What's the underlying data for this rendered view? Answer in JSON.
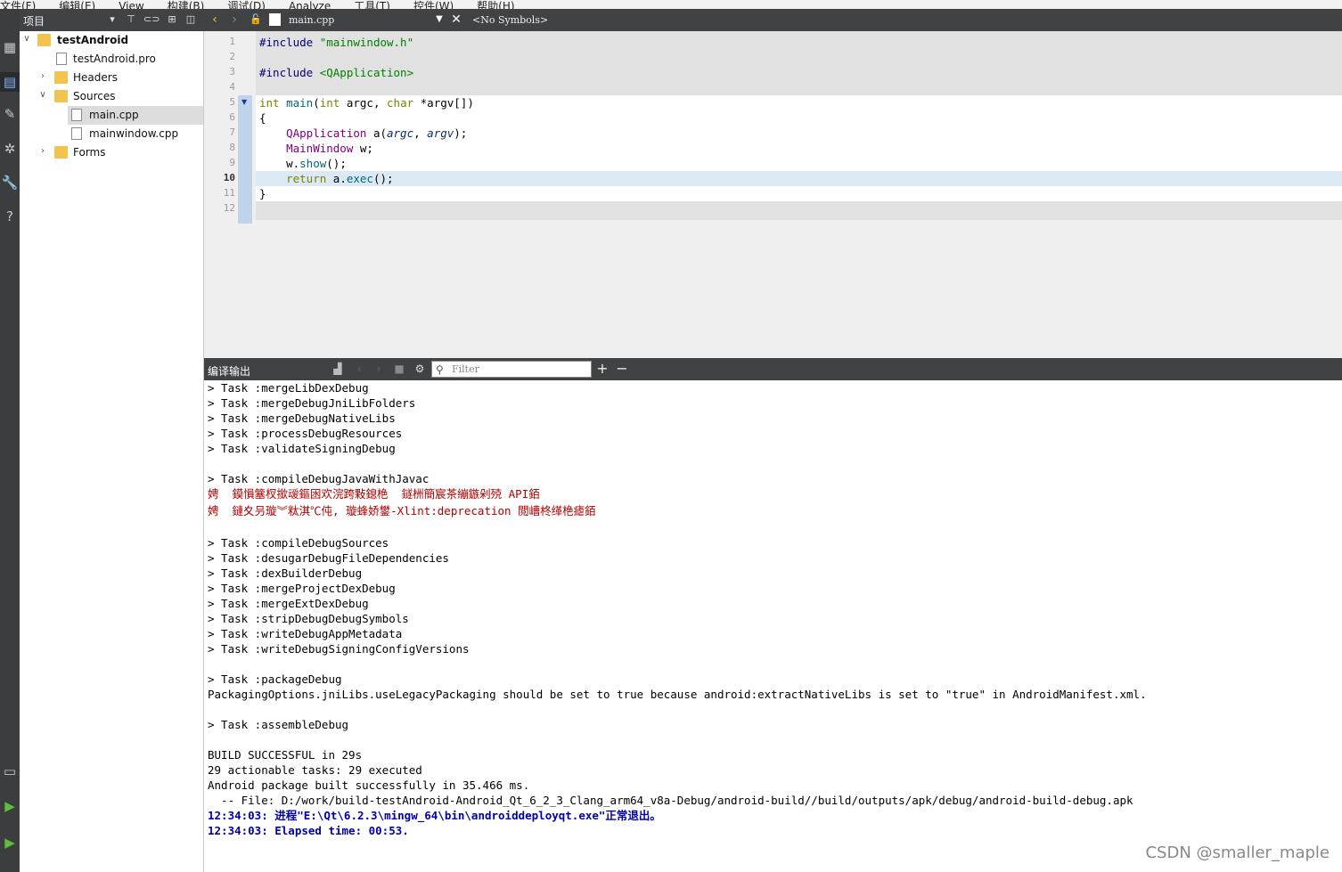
{
  "menubar": [
    "文件(F)",
    "编辑(E)",
    "View",
    "构建(B)",
    "调试(D)",
    "Analyze",
    "工具(T)",
    "控件(W)",
    "帮助(H)"
  ],
  "project_panel": {
    "title": "项目",
    "tree": [
      {
        "label": "testAndroid",
        "type": "project",
        "expanded": true
      },
      {
        "label": "testAndroid.pro",
        "type": "pro-file"
      },
      {
        "label": "Headers",
        "type": "folder",
        "expanded": false
      },
      {
        "label": "Sources",
        "type": "folder",
        "expanded": true
      },
      {
        "label": "main.cpp",
        "type": "cpp-file",
        "selected": true
      },
      {
        "label": "mainwindow.cpp",
        "type": "cpp-file"
      },
      {
        "label": "Forms",
        "type": "folder",
        "expanded": false
      }
    ]
  },
  "editor": {
    "file_name": "main.cpp",
    "symbols": "<No Symbols>",
    "current_line": "10",
    "line_numbers": [
      "1",
      "2",
      "3",
      "4",
      "5",
      "6",
      "7",
      "8",
      "9",
      "10",
      "11",
      "12"
    ],
    "lines": [
      {
        "parts": [
          {
            "t": "#include ",
            "c": "pp"
          },
          {
            "t": "\"mainwindow.h\"",
            "c": "str"
          }
        ]
      },
      {
        "parts": []
      },
      {
        "parts": [
          {
            "t": "#include ",
            "c": "pp"
          },
          {
            "t": "<QApplication>",
            "c": "str"
          }
        ]
      },
      {
        "parts": []
      },
      {
        "parts": [
          {
            "t": "int ",
            "c": "kw"
          },
          {
            "t": "main",
            "c": "fn"
          },
          {
            "t": "(",
            "c": ""
          },
          {
            "t": "int ",
            "c": "kw"
          },
          {
            "t": "argc, ",
            "c": ""
          },
          {
            "t": "char ",
            "c": "kw"
          },
          {
            "t": "*argv[])",
            "c": ""
          }
        ]
      },
      {
        "parts": [
          {
            "t": "{",
            "c": ""
          }
        ]
      },
      {
        "parts": [
          {
            "t": "    QApplication ",
            "c": "ty"
          },
          {
            "t": "a(",
            "c": ""
          },
          {
            "t": "argc",
            "c": "it"
          },
          {
            "t": ", ",
            "c": ""
          },
          {
            "t": "argv",
            "c": "it"
          },
          {
            "t": ");",
            "c": ""
          }
        ]
      },
      {
        "parts": [
          {
            "t": "    MainWindow ",
            "c": "ty"
          },
          {
            "t": "w;",
            "c": ""
          }
        ]
      },
      {
        "parts": [
          {
            "t": "    w.",
            "c": ""
          },
          {
            "t": "show",
            "c": "fn"
          },
          {
            "t": "();",
            "c": ""
          }
        ]
      },
      {
        "parts": [
          {
            "t": "    return ",
            "c": "kw"
          },
          {
            "t": "a.",
            "c": ""
          },
          {
            "t": "exec",
            "c": "fn"
          },
          {
            "t": "();",
            "c": ""
          }
        ]
      },
      {
        "parts": [
          {
            "t": "}",
            "c": ""
          }
        ]
      },
      {
        "parts": []
      }
    ]
  },
  "output_panel": {
    "title": "编译输出",
    "filter_placeholder": "Filter",
    "lines": [
      {
        "text": "> Task :mergeLibDexDebug",
        "style": ""
      },
      {
        "text": "> Task :mergeDebugJniLibFolders",
        "style": ""
      },
      {
        "text": "> Task :mergeDebugNativeLibs",
        "style": ""
      },
      {
        "text": "> Task :processDebugResources",
        "style": ""
      },
      {
        "text": "> Task :validateSigningDebug",
        "style": ""
      },
      {
        "text": "",
        "style": ""
      },
      {
        "text": "> Task :compileDebugJavaWithJavac",
        "style": ""
      },
      {
        "text": "娉  鏌愪簺杈撳叆鏂囦欢浣跨敤鎴栬  鐩栦簡宸茶繃鏃剁殑 API銆",
        "style": "err"
      },
      {
        "text": "娉  鏈夊叧璇︾粏淇℃伅, 璇蜂娇鐢-Xlint:deprecation 閲嶆柊缂栬瘧銆",
        "style": "err"
      },
      {
        "text": "",
        "style": ""
      },
      {
        "text": "> Task :compileDebugSources",
        "style": ""
      },
      {
        "text": "> Task :desugarDebugFileDependencies",
        "style": ""
      },
      {
        "text": "> Task :dexBuilderDebug",
        "style": ""
      },
      {
        "text": "> Task :mergeProjectDexDebug",
        "style": ""
      },
      {
        "text": "> Task :mergeExtDexDebug",
        "style": ""
      },
      {
        "text": "> Task :stripDebugDebugSymbols",
        "style": ""
      },
      {
        "text": "> Task :writeDebugAppMetadata",
        "style": ""
      },
      {
        "text": "> Task :writeDebugSigningConfigVersions",
        "style": ""
      },
      {
        "text": "",
        "style": ""
      },
      {
        "text": "> Task :packageDebug",
        "style": ""
      },
      {
        "text": "PackagingOptions.jniLibs.useLegacyPackaging should be set to true because android:extractNativeLibs is set to \"true\" in AndroidManifest.xml.",
        "style": ""
      },
      {
        "text": "",
        "style": ""
      },
      {
        "text": "> Task :assembleDebug",
        "style": ""
      },
      {
        "text": "",
        "style": ""
      },
      {
        "text": "BUILD SUCCESSFUL in 29s",
        "style": ""
      },
      {
        "text": "29 actionable tasks: 29 executed",
        "style": ""
      },
      {
        "text": "Android package built successfully in 35.466 ms.",
        "style": ""
      },
      {
        "text": "  -- File: D:/work/build-testAndroid-Android_Qt_6_2_3_Clang_arm64_v8a-Debug/android-build//build/outputs/apk/debug/android-build-debug.apk",
        "style": ""
      },
      {
        "text": "12:34:03: 进程\"E:\\Qt\\6.2.3\\mingw_64\\bin\\androiddeployqt.exe\"正常退出。",
        "style": "info"
      },
      {
        "text": "12:34:03: Elapsed time: 00:53.",
        "style": "info"
      }
    ]
  },
  "watermark": "CSDN @smaller_maple",
  "colors": {
    "panel_header": "#404244",
    "mode_bar": "#3b3d3f",
    "current_line": "#dbe9f6",
    "keyword": "#808000",
    "type": "#800080",
    "string": "#008000",
    "error": "#b00000",
    "info": "#0000aa"
  }
}
